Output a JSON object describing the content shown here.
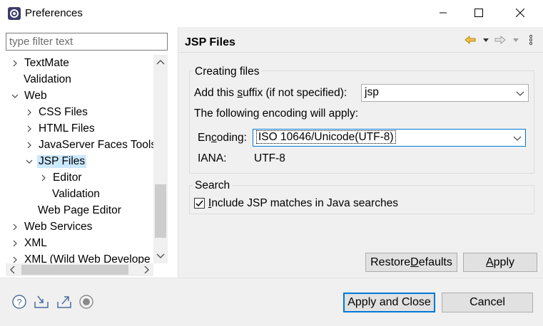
{
  "window": {
    "title": "Preferences",
    "icons": {
      "app": "eclipse-gear-icon",
      "minimize": "minimize-icon",
      "maximize": "maximize-icon",
      "close": "close-icon"
    }
  },
  "filter": {
    "placeholder": "type filter text",
    "value": ""
  },
  "tree": {
    "items": [
      {
        "label": "TextMate",
        "expandable": true,
        "expanded": false
      },
      {
        "label": "Validation",
        "expandable": false
      },
      {
        "label": "Web",
        "expandable": true,
        "expanded": true
      },
      {
        "label": "CSS Files",
        "expandable": true,
        "expanded": false
      },
      {
        "label": "HTML Files",
        "expandable": true,
        "expanded": false
      },
      {
        "label": "JavaServer Faces Tools",
        "expandable": true,
        "expanded": false
      },
      {
        "label": "JSP Files",
        "expandable": true,
        "expanded": true,
        "selected": true
      },
      {
        "label": "Editor",
        "expandable": true,
        "expanded": false
      },
      {
        "label": "Validation",
        "expandable": false
      },
      {
        "label": "Web Page Editor",
        "expandable": false
      },
      {
        "label": "Web Services",
        "expandable": true,
        "expanded": false
      },
      {
        "label": "XML",
        "expandable": true,
        "expanded": false
      },
      {
        "label": "XML (Wild Web Develope",
        "expandable": true,
        "expanded": false
      }
    ]
  },
  "page": {
    "title": "JSP Files",
    "nav_icons": [
      "back-arrow-icon",
      "back-menu-icon",
      "forward-arrow-icon",
      "forward-menu-icon",
      "view-menu-icon"
    ],
    "creating_files": {
      "group_label": "Creating files",
      "suffix_label_pre": "Add this ",
      "suffix_label_u": "s",
      "suffix_label_post": "uffix (if not specified):",
      "suffix_value": "jsp",
      "encoding_intro": "The following encoding will apply:",
      "encoding_label_pre": "En",
      "encoding_label_u": "c",
      "encoding_label_post": "oding:",
      "encoding_value": "ISO 10646/Unicode(UTF-8)",
      "iana_label": "IANA:",
      "iana_value": "UTF-8"
    },
    "search": {
      "group_label": "Search",
      "include_label_u": "I",
      "include_label_post": "nclude JSP matches in Java searches",
      "include_checked": true
    },
    "buttons": {
      "restore_pre": "Restore ",
      "restore_u": "D",
      "restore_post": "efaults",
      "apply_u": "A",
      "apply_post": "pply"
    }
  },
  "footer": {
    "icons": [
      "help-icon",
      "import-icon",
      "export-icon",
      "oomph-record-icon"
    ],
    "apply_close": "Apply and Close",
    "cancel": "Cancel"
  },
  "colors": {
    "selection": "#cce8ff",
    "focus": "#0078d7",
    "panel": "#f0f0f0",
    "nav_back": "#e8a317"
  }
}
